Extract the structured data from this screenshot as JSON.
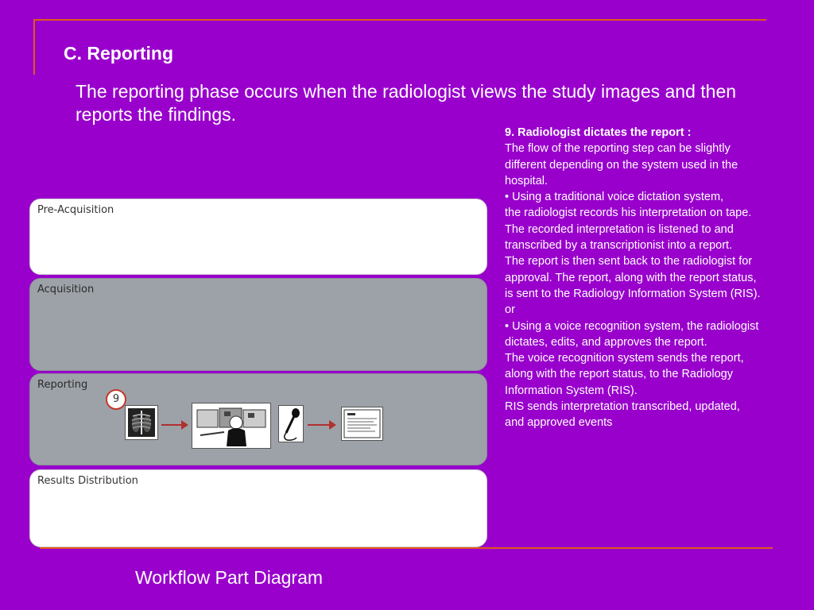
{
  "slide": {
    "heading": "C. Reporting",
    "intro": "The reporting phase occurs when the radiologist views the study images and then reports the findings.",
    "caption": "Workflow Part Diagram"
  },
  "notes": {
    "title": "9. Radiologist dictates the report :",
    "lines": [
      "The flow of the reporting step can be slightly",
      "different depending on the system used in the",
      "hospital.",
      "• Using a traditional voice dictation system,",
      "the radiologist records his interpretation on tape.",
      "The recorded interpretation is listened to and",
      "transcribed by a transcriptionist into a report.",
      "The report is then sent back to the radiologist for",
      "approval. The report, along with the report status,",
      "is sent to the Radiology Information System (RIS).",
      "or",
      "• Using a voice recognition system, the radiologist",
      "dictates, edits, and approves the report.",
      "The voice recognition system sends the report,",
      "along with the report status, to the Radiology",
      "Information System (RIS).",
      "RIS sends interpretation transcribed, updated,",
      "and approved events"
    ]
  },
  "diagram": {
    "lanes": [
      {
        "label": "Pre-Acquisition",
        "style": "white"
      },
      {
        "label": "Acquisition",
        "style": "gray"
      },
      {
        "label": "Reporting",
        "style": "gray"
      },
      {
        "label": "Results Distribution",
        "style": "white"
      }
    ],
    "step_number": "9",
    "icons": [
      "xray-image-icon",
      "radiologist-workstation-icon",
      "microphone-icon",
      "report-document-icon"
    ],
    "colors": {
      "background": "#9900cc",
      "rule": "#e05a1a",
      "arrow": "#b03030"
    }
  }
}
